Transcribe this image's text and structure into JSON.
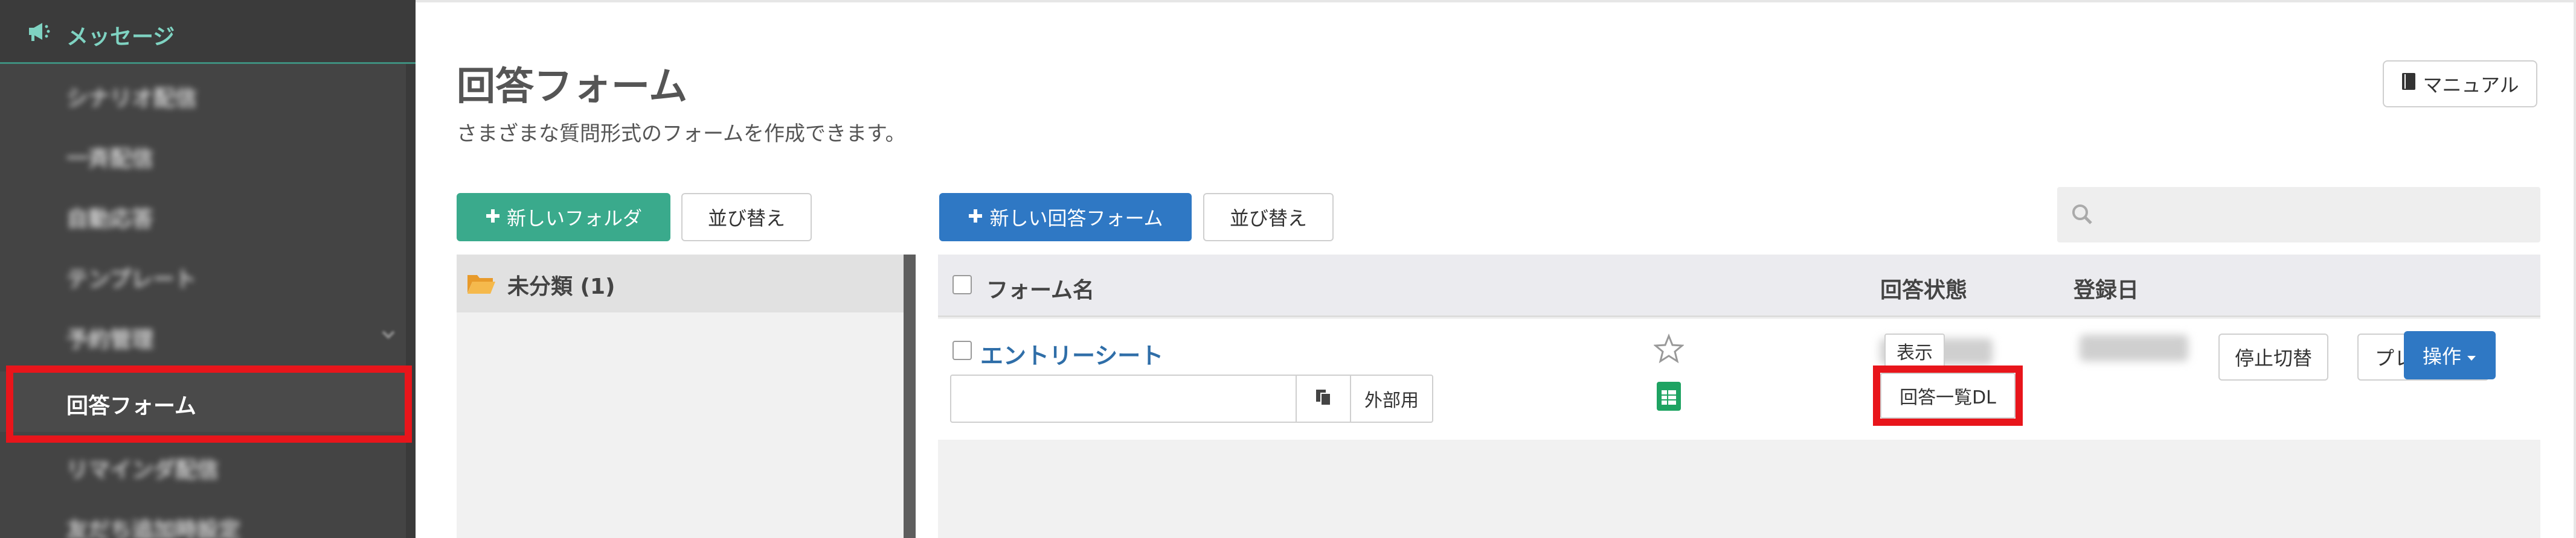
{
  "sidebar": {
    "header": {
      "label": "メッセージ",
      "icon": "megaphone-icon"
    },
    "items": [
      {
        "label": "シナリオ配信"
      },
      {
        "label": "一斉配信"
      },
      {
        "label": "自動応答"
      },
      {
        "label": "テンプレート"
      },
      {
        "label": "予約管理"
      },
      {
        "label": "回答フォーム"
      },
      {
        "label": "リマインダ配信"
      },
      {
        "label": "友だち追加時設定"
      }
    ]
  },
  "page": {
    "title": "回答フォーム",
    "description": "さまざまな質問形式のフォームを作成できます。",
    "manual_label": "マニュアル"
  },
  "toolbar": {
    "new_folder": "新しいフォルダ",
    "sort_folders": "並び替え",
    "new_form": "新しい回答フォーム",
    "sort_forms": "並び替え"
  },
  "folders": [
    {
      "label": "未分類 (1)"
    }
  ],
  "table": {
    "headers": {
      "name": "フォーム名",
      "status": "回答状態",
      "date": "登録日"
    },
    "rows": [
      {
        "name": "エントリーシート",
        "url_value": "",
        "external_label": "外部用",
        "show_label": "表示",
        "download_label": "回答一覧DL",
        "stop_toggle_label": "停止切替",
        "preview_label": "プレビュー",
        "operate_label": "操作"
      }
    ]
  },
  "colors": {
    "accent_green": "#3aaa8c",
    "accent_blue": "#2f78c4",
    "highlight_red": "#e8151b",
    "sidebar_bg": "#444444"
  }
}
